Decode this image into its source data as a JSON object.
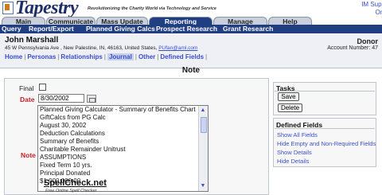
{
  "header": {
    "logo": "Tapestry",
    "tagline": "Revolutionizing the Charity World via Technology and Service",
    "support_line1": "IM Supp",
    "support_line2": "Onl"
  },
  "tabs": [
    {
      "label": "Main"
    },
    {
      "label": "Communicate"
    },
    {
      "label": "Mass Update"
    },
    {
      "label": "Reporting",
      "active": true
    },
    {
      "label": "Manage"
    },
    {
      "label": "Help"
    }
  ],
  "subnav": [
    "Query",
    "Report/Export",
    "Planned Giving Calcs",
    "Prospect Research",
    "Grant Research"
  ],
  "person": {
    "name": "John Marshall",
    "address": "45 W Pennsylvania Ave , New Palestine, IN, 46163, United States, ",
    "email": "PUfan@aml.com",
    "type": "Donor",
    "account": "Account Number: 47",
    "links": [
      "Home",
      "Personas",
      "Relationships",
      "Journal",
      "Other",
      "Defined Fields"
    ],
    "current_link": "Journal"
  },
  "note_section": {
    "header": "Note",
    "final_label": "Final",
    "date_label": "Date",
    "date_value": "8/30/2002",
    "note_label": "Note",
    "note_lines": [
      "Planned Giving Calculator - Summary of Benefits Chart",
      "GiftCalcs from PG Calc",
      "August 30, 2002",
      "Deduction Calculations",
      "Summary of Benefits",
      "Charitable Remainder Unitrust",
      "ASSUMPTIONS",
      "Fixed Term  10 yrs.",
      "Principal Donated",
      "$1,000,000.00"
    ],
    "spell_logo": "SpellCheck.net",
    "spell_sub": "Free Online Spell Checker"
  },
  "tasks": {
    "title": "Tasks",
    "save_label": "Save",
    "delete_label": "Delete"
  },
  "defined_fields": {
    "title": "Defined Fields",
    "links": [
      "Show All Fields",
      "Hide Empty and Non-Required Fields",
      "Show Details",
      "Hide Details"
    ]
  },
  "colors": {
    "nav_blue": "#1f3f82",
    "link_blue": "#3a4fc9",
    "required_red": "#c0222a"
  }
}
